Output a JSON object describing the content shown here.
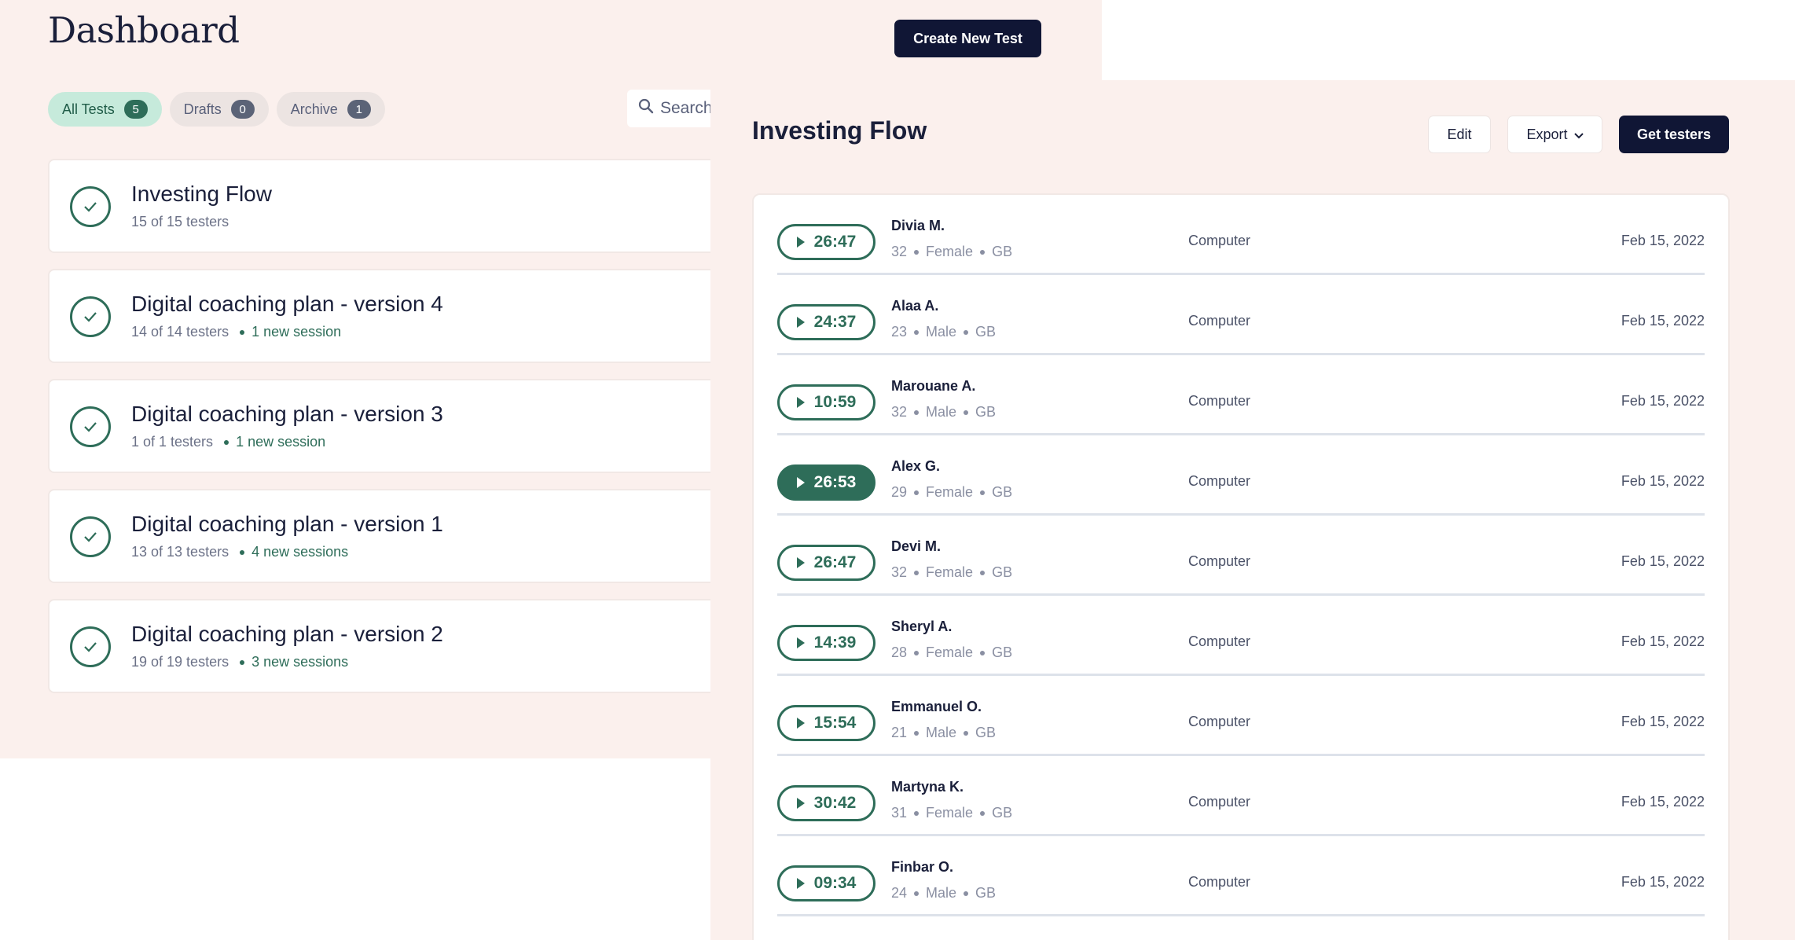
{
  "dashboard": {
    "title": "Dashboard",
    "create_button": "Create New Test",
    "search_placeholder": "Search",
    "filters": [
      {
        "label": "All Tests",
        "count": "5"
      },
      {
        "label": "Drafts",
        "count": "0"
      },
      {
        "label": "Archive",
        "count": "1"
      }
    ],
    "tests": [
      {
        "name": "Investing Flow",
        "testers": "15 of 15 testers",
        "new_sessions": ""
      },
      {
        "name": "Digital coaching plan - version 4",
        "testers": "14 of 14 testers",
        "new_sessions": "1 new session"
      },
      {
        "name": "Digital coaching plan - version 3",
        "testers": "1 of 1 testers",
        "new_sessions": "1 new session"
      },
      {
        "name": "Digital coaching plan - version 1",
        "testers": "13 of 13 testers",
        "new_sessions": "4 new sessions"
      },
      {
        "name": "Digital coaching plan - version 2",
        "testers": "19 of 19 testers",
        "new_sessions": "3 new sessions"
      }
    ]
  },
  "detail": {
    "title": "Investing Flow",
    "edit_button": "Edit",
    "export_button": "Export",
    "get_testers_button": "Get testers",
    "sessions": [
      {
        "duration": "26:47",
        "name": "Divia M.",
        "age": "32",
        "gender": "Female",
        "country": "GB",
        "device": "Computer",
        "date": "Feb 15, 2022"
      },
      {
        "duration": "24:37",
        "name": "Alaa A.",
        "age": "23",
        "gender": "Male",
        "country": "GB",
        "device": "Computer",
        "date": "Feb 15, 2022"
      },
      {
        "duration": "10:59",
        "name": "Marouane A.",
        "age": "32",
        "gender": "Male",
        "country": "GB",
        "device": "Computer",
        "date": "Feb 15, 2022"
      },
      {
        "duration": "26:53",
        "name": "Alex G.",
        "age": "29",
        "gender": "Female",
        "country": "GB",
        "device": "Computer",
        "date": "Feb 15, 2022"
      },
      {
        "duration": "26:47",
        "name": "Devi M.",
        "age": "32",
        "gender": "Female",
        "country": "GB",
        "device": "Computer",
        "date": "Feb 15, 2022"
      },
      {
        "duration": "14:39",
        "name": "Sheryl A.",
        "age": "28",
        "gender": "Female",
        "country": "GB",
        "device": "Computer",
        "date": "Feb 15, 2022"
      },
      {
        "duration": "15:54",
        "name": "Emmanuel O.",
        "age": "21",
        "gender": "Male",
        "country": "GB",
        "device": "Computer",
        "date": "Feb 15, 2022"
      },
      {
        "duration": "30:42",
        "name": "Martyna K.",
        "age": "31",
        "gender": "Female",
        "country": "GB",
        "device": "Computer",
        "date": "Feb 15, 2022"
      },
      {
        "duration": "09:34",
        "name": "Finbar O.",
        "age": "24",
        "gender": "Male",
        "country": "GB",
        "device": "Computer",
        "date": "Feb 15, 2022"
      }
    ]
  },
  "colors": {
    "accent_green": "#2e6d59",
    "navy": "#101635",
    "background": "#fbf0ed"
  },
  "icons": {
    "search": "search-icon",
    "check": "check-circle-icon",
    "play": "play-icon",
    "chevron": "chevron-down-icon"
  }
}
